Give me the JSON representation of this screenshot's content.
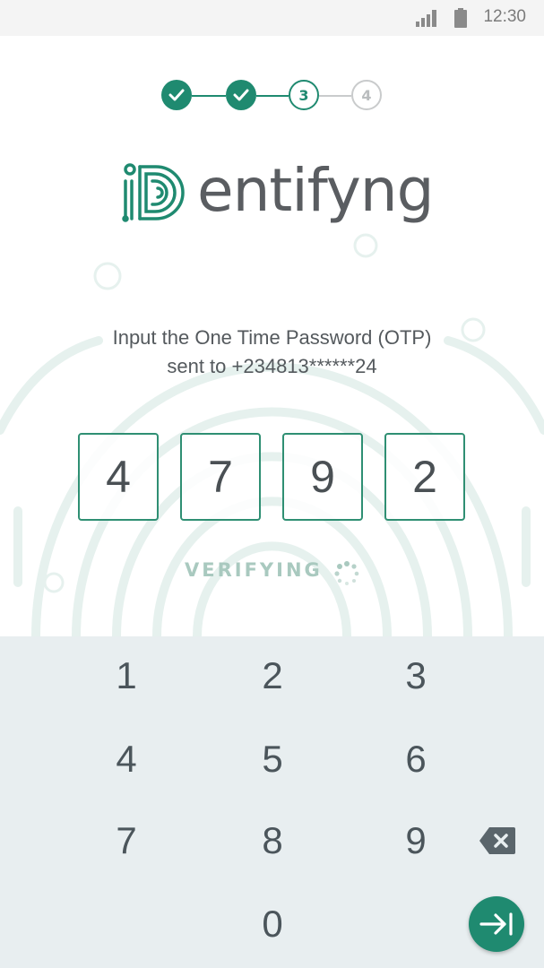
{
  "status_bar": {
    "time": "12:30"
  },
  "stepper": {
    "steps": [
      {
        "state": "done",
        "label": ""
      },
      {
        "state": "done",
        "label": ""
      },
      {
        "state": "current",
        "label": "3"
      },
      {
        "state": "todo",
        "label": "4"
      }
    ]
  },
  "logo": {
    "text": "entifyng"
  },
  "instruction": {
    "line1": "Input the One Time Password (OTP)",
    "line2": "sent to +234813******24"
  },
  "otp": {
    "digits": [
      "4",
      "7",
      "9",
      "2"
    ]
  },
  "verifying": {
    "label": "VERIFYING"
  },
  "keypad": {
    "keys": [
      "1",
      "2",
      "3",
      "4",
      "5",
      "6",
      "7",
      "8",
      "9",
      "0"
    ],
    "backspace_icon": "backspace-icon",
    "submit_icon": "arrow-to-end-icon"
  },
  "colors": {
    "accent": "#1f8a70",
    "keypad_bg": "#e8eef0",
    "status_bg": "#f4f4f4",
    "text": "#54595d"
  }
}
